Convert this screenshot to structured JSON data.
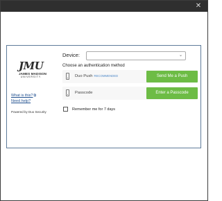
{
  "window": {
    "close_glyph": "✕"
  },
  "brand": {
    "logo_mark": "JMU",
    "logo_name": "JAMES MADISON",
    "logo_sub": "UNIVERSITY.",
    "help_links": [
      {
        "label": "What is this?"
      },
      {
        "label": "Need help?"
      }
    ],
    "powered_by": "Powered by Duo Security"
  },
  "auth": {
    "device_label": "Device:",
    "device_value": "",
    "method_title": "Choose an authentication method",
    "methods": [
      {
        "label": "Duo Push",
        "badge": "RECOMMENDED",
        "button": "Send Me a Push",
        "icon": "phone-icon"
      },
      {
        "label": "Passcode",
        "badge": "",
        "button": "Enter a Passcode",
        "icon": "phone-icon"
      }
    ],
    "remember_label": "Remember me for 7 days",
    "remember_checked": false
  },
  "colors": {
    "button_green": "#6dbc45",
    "link_blue": "#1f4f8f",
    "recommended_blue": "#4a86c7",
    "frame_border": "#5e7b9a",
    "titlebar": "#2f2f2f"
  }
}
